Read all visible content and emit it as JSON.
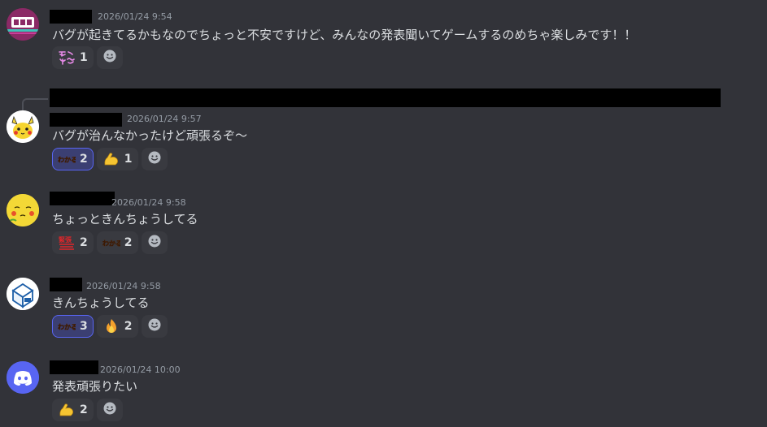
{
  "messages": [
    {
      "timestamp": "2026/01/24 9:54",
      "text": "バグが起きてるかもなのでちょっと不安ですけど、みんなの発表聞いてゲームするのめちゃ楽しみです！！",
      "reactions": [
        {
          "emoji": "tanoshimi-sticker-icon",
          "label": "たの しみ",
          "count": "1"
        }
      ]
    },
    {
      "timestamp": "2026/01/24 9:57",
      "text": "バグが治んなかったけど頑張るぞ〜",
      "reactions": [
        {
          "emoji": "wakaru-sticker-icon",
          "label": "わかる",
          "count": "2"
        },
        {
          "emoji": "flexed-biceps-icon",
          "count": "1"
        }
      ]
    },
    {
      "timestamp": "2026/01/24 9:58",
      "text": "ちょっときんちょうしてる",
      "reactions": [
        {
          "emoji": "kinchou-sticker-icon",
          "label": "緊張",
          "count": "2"
        },
        {
          "emoji": "wakaru-sticker-icon",
          "label": "わかる",
          "count": "2"
        }
      ]
    },
    {
      "timestamp": "2026/01/24 9:58",
      "text": "きんちょうしてる",
      "reactions": [
        {
          "emoji": "wakaru-sticker-icon",
          "label": "わかる",
          "count": "3"
        },
        {
          "emoji": "fire-icon",
          "count": "2"
        }
      ]
    },
    {
      "timestamp": "2026/01/24 10:00",
      "text": "発表頑張りたい",
      "reactions": [
        {
          "emoji": "flexed-biceps-icon",
          "count": "2"
        }
      ]
    }
  ],
  "colors": {
    "background": "#323339",
    "reaction_bg": "#393a40",
    "reaction_me_bg": "#3b3f72",
    "reaction_me_border": "#5865f2",
    "timestamp": "#949ba4",
    "text": "#dbdee1",
    "discord_blurple": "#5865f2"
  }
}
